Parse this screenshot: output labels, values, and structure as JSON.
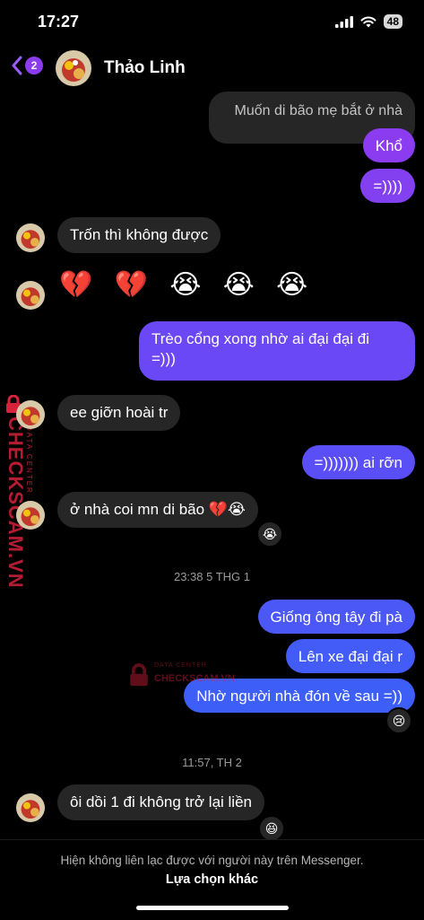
{
  "status_bar": {
    "time": "17:27",
    "battery": "48"
  },
  "header": {
    "back_badge": "2",
    "contact_name": "Thảo Linh"
  },
  "messages": [
    {
      "side": "right",
      "text": "Muốn di bão mẹ bắt ở nhà",
      "style": "gray"
    },
    {
      "side": "right",
      "text": "Khổ"
    },
    {
      "side": "right",
      "text": "=))))"
    },
    {
      "side": "left",
      "text": "Trốn thì không được"
    },
    {
      "side": "left",
      "text": "💔 💔 😭 😭 😭",
      "style": "emoji"
    },
    {
      "side": "right",
      "lines": [
        "Trèo cổng xong nhờ ai đại đại đi",
        "=)))"
      ]
    },
    {
      "side": "left",
      "text": "ee giỡn hoài tr"
    },
    {
      "side": "right",
      "text": "=))))))) ai rỡn"
    },
    {
      "side": "left",
      "text": "ở nhà coi mn di bão 💔😭",
      "reaction": "😭"
    },
    {
      "side": "right",
      "text": "Giống ông tây đi pà"
    },
    {
      "side": "right",
      "text": "Lên xe đại đại r"
    },
    {
      "side": "right",
      "text": "Nhờ người nhà đón về sau =))",
      "reaction": "😢"
    },
    {
      "side": "left",
      "text": "ôi dồi 1 đi không trở lại liền",
      "reaction": "😆"
    }
  ],
  "timestamps": [
    "23:38 5 THG 1",
    "11:57, TH 2"
  ],
  "footer": {
    "notice": "Hiện không liên lạc được với người này trên Messenger.",
    "action": "Lựa chọn khác"
  },
  "watermark": {
    "brand": "CHECKSCAM.VN",
    "tagline": "DATA CENTER"
  },
  "colors": {
    "background": "#000000",
    "incoming_bubble": "#262626",
    "outgoing_top": "#8c3cf0",
    "outgoing_mid": "#6a48f5",
    "outgoing_bottom": "#3d5ff7",
    "watermark": "#d6223a"
  },
  "icons": [
    "signal-icon",
    "wifi-icon",
    "battery-icon",
    "back-chevron-icon",
    "avatar-image"
  ]
}
